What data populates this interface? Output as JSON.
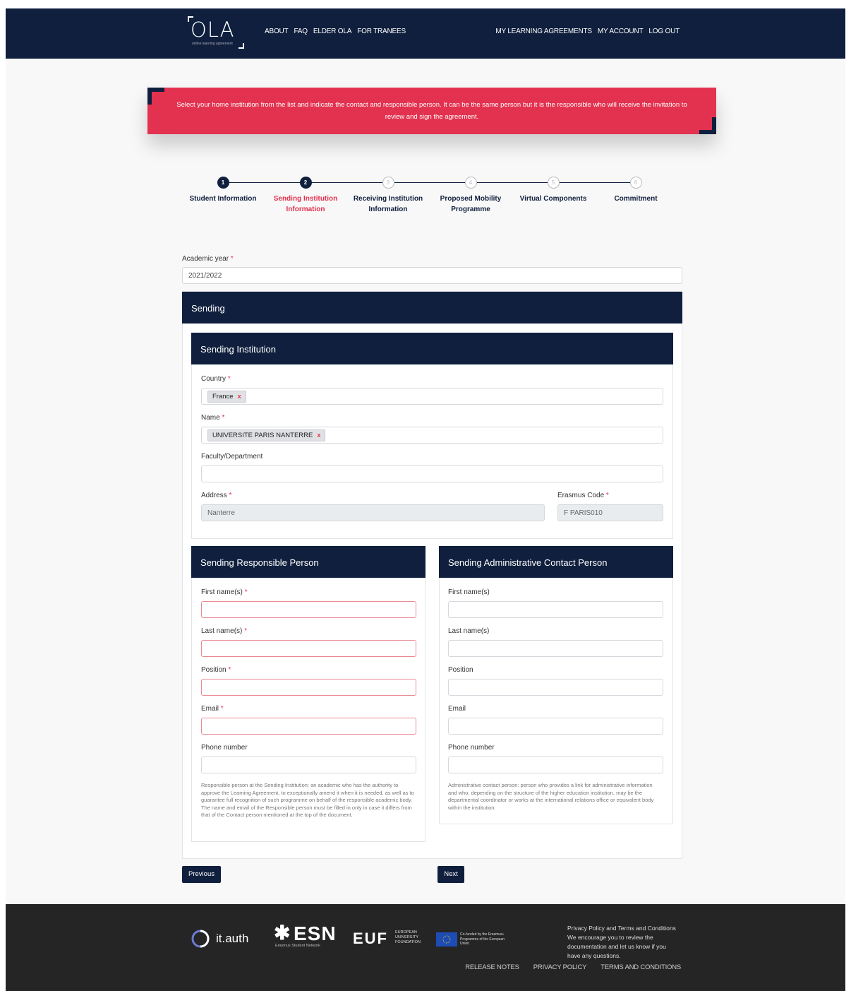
{
  "nav": {
    "logo_text": "OLA",
    "logo_tagline": "online learning agreement",
    "left_links": [
      "ABOUT",
      "FAQ",
      "ELDER OLA",
      "FOR TRANEES"
    ],
    "right_links": [
      "MY LEARNING AGREEMENTS",
      "MY ACCOUNT",
      "LOG OUT"
    ]
  },
  "banner": {
    "text": "Select your home institution from the list and indicate the contact and responsible person. It can be the same person but it is the responsible who will receive the invitation to review and sign the agreement."
  },
  "stepper": {
    "steps": [
      {
        "num": "1",
        "label": "Student Information",
        "state": "done"
      },
      {
        "num": "2",
        "label": "Sending Institution Information",
        "state": "active"
      },
      {
        "num": "3",
        "label": "Receiving Institution Information",
        "state": "todo"
      },
      {
        "num": "4",
        "label": "Proposed Mobility Programme",
        "state": "todo"
      },
      {
        "num": "5",
        "label": "Virtual Components",
        "state": "todo"
      },
      {
        "num": "6",
        "label": "Commitment",
        "state": "todo"
      }
    ]
  },
  "form": {
    "academic_year_label": "Academic year",
    "academic_year_value": "2021/2022",
    "required_mark": "*",
    "sending_title": "Sending",
    "institution": {
      "title": "Sending Institution",
      "country_label": "Country",
      "country_value": "France",
      "name_label": "Name",
      "name_value": "UNIVERSITE PARIS NANTERRE",
      "faculty_label": "Faculty/Department",
      "faculty_value": "",
      "address_label": "Address",
      "address_value": "Nanterre",
      "erasmus_label": "Erasmus Code",
      "erasmus_value": "F PARIS010",
      "remove_symbol": "x"
    },
    "responsible": {
      "title": "Sending Responsible Person",
      "first_label": "First name(s)",
      "last_label": "Last name(s)",
      "position_label": "Position",
      "email_label": "Email",
      "phone_label": "Phone number",
      "note": "Responsible person at the Sending Institution: an academic who has the authority to approve the Learning Agreement, to exceptionally amend it when it is needed, as well as to guarantee full recognition of such programme on behalf of the responsible academic body. The name and email of the Responsible person must be filled in only in case it differs from that of the Contact person mentioned at the top of the document."
    },
    "contact": {
      "title": "Sending Administrative Contact Person",
      "first_label": "First name(s)",
      "last_label": "Last name(s)",
      "position_label": "Position",
      "email_label": "Email",
      "phone_label": "Phone number",
      "note": "Administrative contact person: person who provides a link for administrative information and who, depending on the structure of the higher education institution, may be the departmental coordinator or works at the international relations office or equivalent body within the institution."
    },
    "prev_label": "Previous",
    "next_label": "Next"
  },
  "footer": {
    "itauth": "it.auth",
    "esn": "ESN",
    "esn_sub": "Erasmus Student Network",
    "euf": "EUF",
    "euf_sub": "EUROPEAN UNIVERSITY FOUNDATION",
    "eu_sub": "Co-funded by the Erasmus+ Programme of the European Union",
    "text_lines": [
      "Privacy Policy and Terms and Conditions",
      "We encourage you to review the",
      "documentation and let us know if you",
      "have any questions."
    ],
    "links": [
      "RELEASE NOTES",
      "PRIVACY POLICY",
      "TERMS AND CONDITIONS"
    ],
    "colors": {
      "navy": "#0f1f3d",
      "accent": "#e3324f",
      "footer": "#252525"
    }
  }
}
